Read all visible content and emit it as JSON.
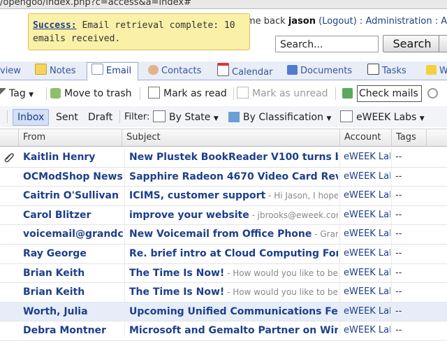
{
  "browser": {
    "url": "/opengoo/index.php?c=access&a=index#"
  },
  "header": {
    "welcome_prefix": "me back ",
    "user": "jason",
    "logout": "(Logout)",
    "sep": " : ",
    "admin": "Administration",
    "admin2": " : A",
    "search_placeholder": "Search...",
    "search_button": "Search"
  },
  "notice": {
    "label": "Success:",
    "text": " Email retrieval complete: 10 emails received."
  },
  "tabs": [
    {
      "label": "view"
    },
    {
      "label": "Notes"
    },
    {
      "label": "Email"
    },
    {
      "label": "Contacts"
    },
    {
      "label": "Calendar"
    },
    {
      "label": "Documents"
    },
    {
      "label": "Tasks"
    },
    {
      "label": "W"
    }
  ],
  "toolbar": {
    "tag": "Tag",
    "trash": "Move to trash",
    "mark_read": "Mark as read",
    "mark_unread": "Mark as unread",
    "check": "Check mails"
  },
  "folders": {
    "inbox": "Inbox",
    "sent": "Sent",
    "draft": "Draft",
    "filter": "Filter:",
    "by_state": "By State",
    "by_class": "By Classification",
    "account": "eWEEK Labs"
  },
  "columns": {
    "from": "From",
    "subject": "Subject",
    "account": "Account",
    "tags": "Tags"
  },
  "emails": [
    {
      "from": "Kaitlin Henry",
      "subject": "New Plustek BookReader V100 turns bo",
      "preview": "",
      "account": "eWEEK Lal",
      "tags": "--"
    },
    {
      "from": "OCModShop News",
      "subject": "Sapphire Radeon 4670 Video Card Revi",
      "preview": "",
      "account": "eWEEK Lal",
      "tags": "--"
    },
    {
      "from": "Caitrin O'Sullivan",
      "subject": "ICIMS, customer support",
      "preview": " - Hi Jason, I hope",
      "account": "eWEEK Lal",
      "tags": "--"
    },
    {
      "from": "Carol Blitzer",
      "subject": "improve your website",
      "preview": " - jbrooks@eweek.com",
      "account": "eWEEK Lal",
      "tags": "--"
    },
    {
      "from": "voicemail@grandc",
      "subject": "New Voicemail from Office Phone",
      "preview": " - Grand",
      "account": "eWEEK Lal",
      "tags": "--"
    },
    {
      "from": "Ray George",
      "subject": "Re. brief intro at Cloud Computing Foru",
      "preview": "",
      "account": "eWEEK Lal",
      "tags": "--"
    },
    {
      "from": "Brian Keith",
      "subject": "The Time Is Now!",
      "preview": " - How would you like to be fi",
      "account": "eWEEK Lal",
      "tags": "--"
    },
    {
      "from": "Brian Keith",
      "subject": "The Time Is Now!",
      "preview": " - How would you like to be fi",
      "account": "eWEEK Lal",
      "tags": "--"
    },
    {
      "from": "Worth, Julia",
      "subject": "Upcoming Unified Communications Fe",
      "preview": "",
      "account": "eWEEK Lal",
      "tags": "--"
    },
    {
      "from": "Debra Montner",
      "subject": "Microsoft and Gemalto Partner on Wind",
      "preview": "",
      "account": "eWEEK Lal",
      "tags": "--"
    }
  ],
  "colors": {
    "link": "#1d3f8a",
    "tab_bg": "#e8edf7",
    "notice_bg": "#fbf0a8",
    "selected_row": "#e6edf9"
  },
  "icons": [
    "notes-icon",
    "email-icon",
    "contacts-icon",
    "calendar-icon",
    "documents-icon",
    "tasks-icon",
    "tag-icon",
    "trash-icon",
    "mark-read-icon",
    "mark-unread-icon",
    "check-mail-icon",
    "gear-icon",
    "inbox-filter-icon",
    "classification-icon",
    "account-icon",
    "attachment-icon"
  ]
}
